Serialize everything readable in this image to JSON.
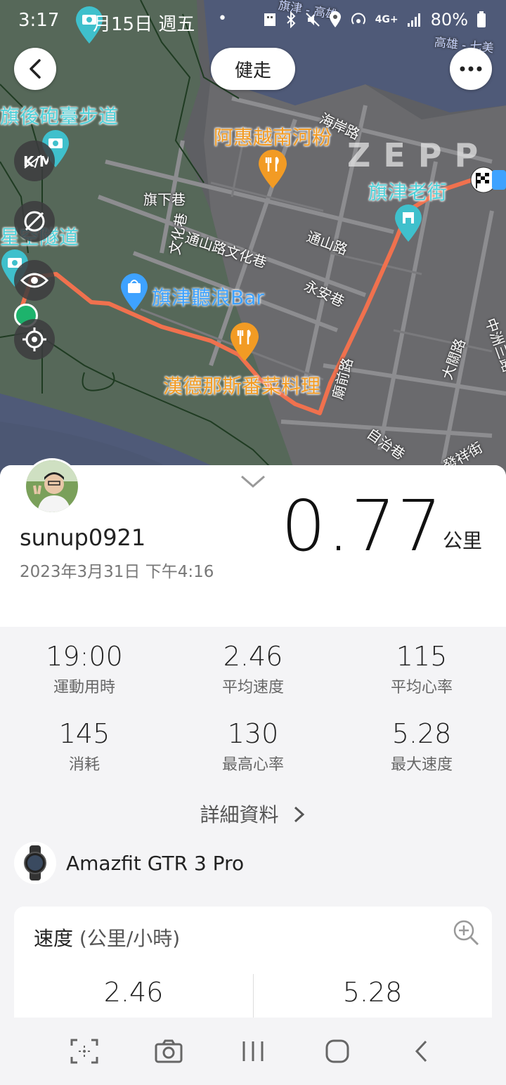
{
  "status_bar": {
    "time": "3:17",
    "date": "月15日 週五",
    "dot": "•",
    "network": "4G+",
    "battery": "80%"
  },
  "map": {
    "mode_label": "健走",
    "watermark": "ZEPP",
    "route_color": "#f0714e",
    "pois": {
      "walkway": "旗後砲臺步道",
      "tunnel": "星空隧道",
      "pho": "阿惠越南河粉",
      "old_street": "旗津老街",
      "bar": "旗津聽浪Bar",
      "restaurant": "漢德那斯番菜料理"
    },
    "streets": {
      "haian": "海岸路",
      "qixia": "旗下巷",
      "wenhua": "文化巷",
      "tongshan_wenhua": "通山路文化巷",
      "tongshan": "通山路",
      "yongan": "永安巷",
      "miaoqian": "廟前路",
      "dakuan": "大關路",
      "zizhi": "自治巷",
      "fuxing": "發祥街",
      "zhongzhou": "中洲三路",
      "ferry_line": "高雄 - 七美",
      "top_label": "旗津 - 高雄"
    }
  },
  "summary": {
    "username": "sunup0921",
    "datetime": "2023年3月31日 下午4:16",
    "distance": "0.77",
    "unit": "公里"
  },
  "stats": [
    {
      "value": "19:00",
      "label": "運動用時"
    },
    {
      "value": "2.46",
      "label": "平均速度"
    },
    {
      "value": "115",
      "label": "平均心率"
    },
    {
      "value": "145",
      "label": "消耗"
    },
    {
      "value": "130",
      "label": "最高心率"
    },
    {
      "value": "5.28",
      "label": "最大速度"
    }
  ],
  "details_label": "詳細資料",
  "device_name": "Amazfit GTR 3 Pro",
  "speed_card": {
    "title": "速度",
    "unit": "(公里/小時)",
    "avg": "2.46",
    "max": "5.28"
  }
}
